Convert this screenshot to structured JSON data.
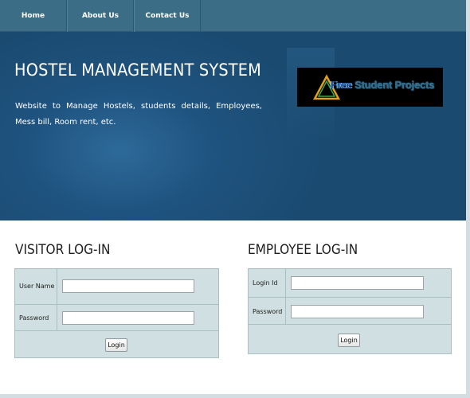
{
  "nav": {
    "items": [
      {
        "label": "Home"
      },
      {
        "label": "About Us"
      },
      {
        "label": "Contact Us"
      }
    ]
  },
  "hero": {
    "title": "HOSTEL MANAGEMENT SYSTEM",
    "description": "Website to Manage Hostels, students details, Employees, Mess bill, Room rent, etc.",
    "logo": {
      "prefix": "Free",
      "suffix": " Student Projects"
    }
  },
  "visitor_login": {
    "title": "VISITOR LOG-IN",
    "username_label": "User Name",
    "username_value": "",
    "password_label": "Password",
    "password_value": "",
    "button_label": "Login"
  },
  "employee_login": {
    "title": "EMPLOYEE LOG-IN",
    "loginid_label": "Login Id",
    "loginid_value": "",
    "password_label": "Password",
    "password_value": "",
    "button_label": "Login"
  },
  "colors": {
    "nav_bg": "#3b6d87",
    "hero_bg": "#1f537f",
    "form_bg": "#d0dfe1"
  }
}
